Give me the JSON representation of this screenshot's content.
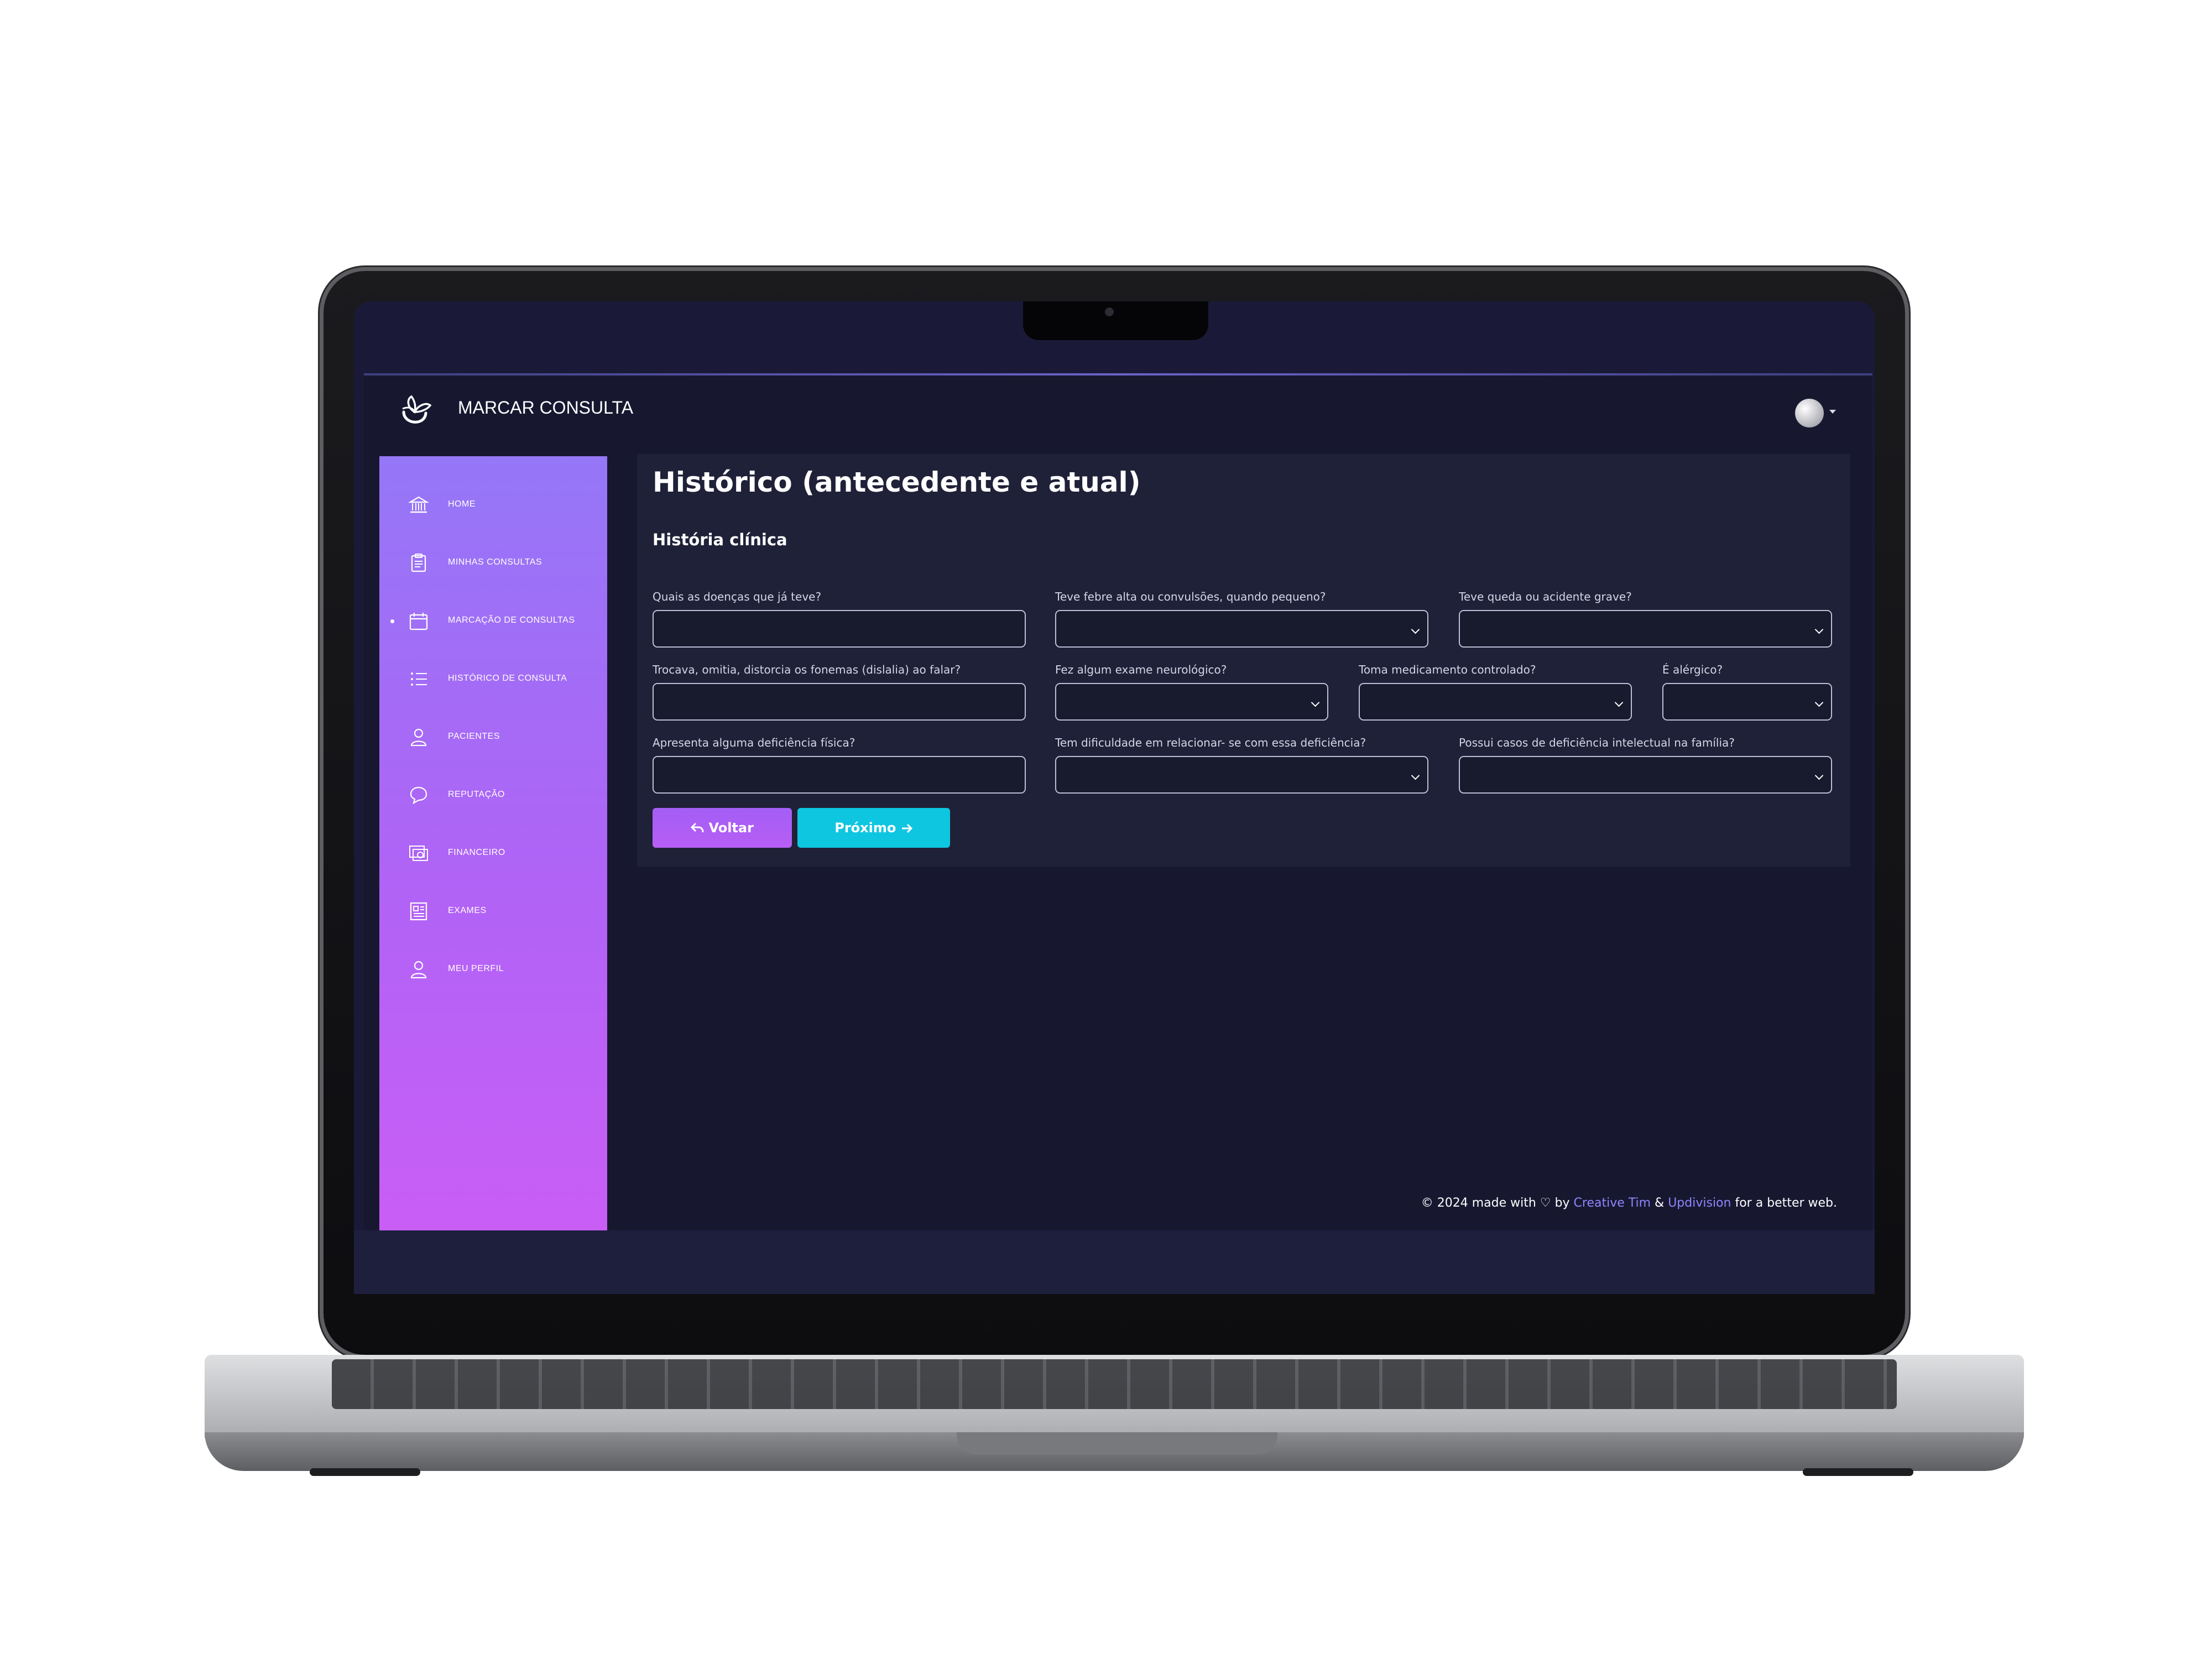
{
  "app": {
    "brand": "MARCAR CONSULTA",
    "brand_icon": "flower-logo-icon",
    "avatar_icon": "user-avatar-icon"
  },
  "sidebar": {
    "items": [
      {
        "label": "HOME",
        "icon": "bank-icon"
      },
      {
        "label": "MINHAS CONSULTAS",
        "icon": "clipboard-icon"
      },
      {
        "label": "MARCAÇÃO DE CONSULTAS",
        "icon": "calendar-icon",
        "active": true
      },
      {
        "label": "HISTÓRICO DE CONSULTA",
        "icon": "list-icon"
      },
      {
        "label": "PACIENTES",
        "icon": "person-icon"
      },
      {
        "label": "REPUTAÇÃO",
        "icon": "chat-bubble-icon"
      },
      {
        "label": "FINANCEIRO",
        "icon": "money-icon"
      },
      {
        "label": "EXAMES",
        "icon": "document-icon"
      },
      {
        "label": "MEU PERFIL",
        "icon": "person-icon"
      }
    ]
  },
  "main": {
    "title": "Histórico (antecedente e atual)",
    "section": "História clínica",
    "fields": [
      {
        "label": "Quais as doenças que já teve?",
        "type": "text",
        "value": ""
      },
      {
        "label": "Teve febre alta ou convulsões, quando pequeno?",
        "type": "select",
        "value": ""
      },
      {
        "label": "Teve queda ou acidente grave?",
        "type": "select",
        "value": ""
      },
      {
        "label": "Trocava, omitia, distorcia os fonemas (dislalia) ao falar?",
        "type": "text",
        "value": ""
      },
      {
        "label": "Fez algum exame neurológico?",
        "type": "select",
        "value": ""
      },
      {
        "label": "Toma medicamento controlado?",
        "type": "select",
        "value": ""
      },
      {
        "label": "É alérgico?",
        "type": "select",
        "value": ""
      },
      {
        "label": "Apresenta alguma deficiência física?",
        "type": "text",
        "value": ""
      },
      {
        "label": "Tem dificuldade em relacionar- se com essa deficiência?",
        "type": "select",
        "value": ""
      },
      {
        "label": "Possui casos de deficiência intelectual na família?",
        "type": "select",
        "value": ""
      }
    ],
    "buttons": {
      "back": "Voltar",
      "back_icon": "reply-arrow-icon",
      "next": "Próximo",
      "next_icon": "arrow-right-icon"
    }
  },
  "footer": {
    "prefix": "© 2024 made with",
    "heart_icon": "heart-icon",
    "by": "by",
    "link1": "Creative Tim",
    "amp": "&",
    "link2": "Updivision",
    "suffix": "for a better web."
  },
  "colors": {
    "sidebar_top": "#9577f7",
    "sidebar_bottom": "#c95ef5",
    "button_back": "#a35ef5",
    "button_next": "#0fc6e0",
    "panel": "#1f2138",
    "background": "#171830"
  }
}
